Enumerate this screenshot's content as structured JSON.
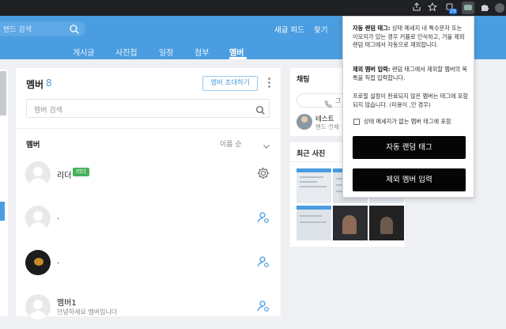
{
  "browser": {
    "extension_badge": "29",
    "icons": [
      "share-icon",
      "star-icon",
      "extension-icon",
      "puzzle-icon",
      "profile-icon"
    ]
  },
  "header": {
    "search_placeholder": "밴드 검색",
    "links": [
      "새글 피드",
      "찾기"
    ],
    "subnav": [
      "게시글",
      "사진첩",
      "일정",
      "첨부",
      "멤버"
    ],
    "active_tab": "멤버"
  },
  "members": {
    "title": "멤버",
    "count": "8",
    "invite_label": "멤버 초대하기",
    "search_placeholder": "멤버 검색",
    "section_label": "멤버",
    "sort_label": "이름 순",
    "rows": [
      {
        "name": "리더",
        "badge": "리더",
        "subtitle": ""
      },
      {
        "name": ".",
        "badge": "",
        "subtitle": ""
      },
      {
        "name": ".",
        "badge": "",
        "subtitle": ""
      },
      {
        "name": "멤버1",
        "badge": "",
        "subtitle": "안녕하세요 멤버입니다"
      }
    ]
  },
  "chat": {
    "title": "채팅",
    "pill_text": "그",
    "member_name": "테스트",
    "member_sub": "밴드 전체"
  },
  "photos": {
    "title": "최근 사진"
  },
  "popup": {
    "para1_bold": "자동 랜덤 태그:",
    "para1": " 상태 메세지 내 특수문자 또는 이모지가 있는 경우 커플로 인식하고, 거울 제외 랜덤 태그에서 자동으로 제외합니다.",
    "para2_bold": "제외 멤버 입력:",
    "para2": " 랜덤 태그에서 제외할 멤버의 목록을 직접 입력합니다.",
    "para3": "프로필 설정이 완료되지 않은 멤버는 태그에 포함되지 않습니다. (미용이 ,인 경우)",
    "checkbox_label": "상태 메세지가 없는 멤버 태그에 포함",
    "btn_random": "자동 랜덤 태그",
    "btn_exclude": "제외 멤버 입력"
  },
  "colors": {
    "brand_blue": "#4a9de0",
    "leader_green": "#46b05a",
    "popup_button": "#050505"
  }
}
